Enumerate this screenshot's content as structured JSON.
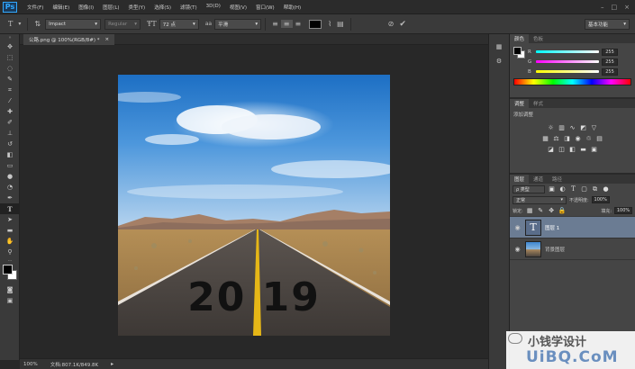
{
  "app": {
    "logo": "Ps"
  },
  "menu": [
    "文件(F)",
    "编辑(E)",
    "图像(I)",
    "图层(L)",
    "类型(Y)",
    "选择(S)",
    "滤镜(T)",
    "3D(D)",
    "视图(V)",
    "窗口(W)",
    "帮助(H)"
  ],
  "window_controls": [
    "–",
    "□",
    "×"
  ],
  "options": {
    "font_family": "Impact",
    "font_style": "Regular",
    "font_size": "72 点",
    "aa_label": "aa",
    "aa_mode": "平滑",
    "workspace": "基本功能"
  },
  "document": {
    "tab_label": "公路.png @ 100%(RGB/8#) *",
    "tab_close": "×",
    "year_text": "20 19",
    "zoom": "100%",
    "doc_info": "文档:807.1K/849.8K"
  },
  "color_panel": {
    "tabs": [
      "颜色",
      "色板"
    ],
    "channels": [
      {
        "label": "R",
        "value": "255"
      },
      {
        "label": "G",
        "value": "255"
      },
      {
        "label": "B",
        "value": "255"
      }
    ]
  },
  "adjust_panel": {
    "tabs": [
      "调整",
      "样式"
    ],
    "title": "添加调整"
  },
  "layers_panel": {
    "tabs": [
      "图层",
      "通道",
      "路径"
    ],
    "filter_label": "ρ 类型",
    "blend_mode": "正常",
    "opacity_label": "不透明度:",
    "opacity_value": "100%",
    "lock_label": "锁定:",
    "fill_label": "填充:",
    "fill_value": "100%",
    "layers": [
      {
        "name": "图层 1",
        "type": "text",
        "selected": true
      },
      {
        "name": "背景图层",
        "type": "image",
        "selected": false
      }
    ],
    "footer_icons": [
      "link-icon",
      "fx-icon",
      "mask-icon",
      "adjustment-icon",
      "folder-icon",
      "new-layer-icon",
      "trash-icon"
    ]
  },
  "watermark": {
    "text": "小钱学设计",
    "url_text": "UiBQ.CoM"
  },
  "colors": {
    "accent": "#31a8ff",
    "panel_bg": "#454545",
    "selected_layer": "#6b7c93"
  }
}
